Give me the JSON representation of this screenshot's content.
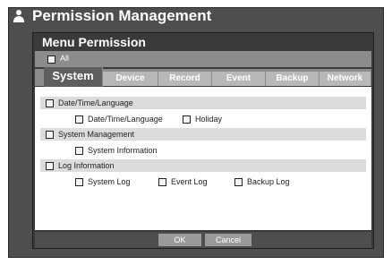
{
  "window": {
    "title": "Permission Management"
  },
  "dialog": {
    "title": "Menu Permission",
    "all_label": "All",
    "tabs": [
      {
        "label": "System"
      },
      {
        "label": "Device"
      },
      {
        "label": "Record"
      },
      {
        "label": "Event"
      },
      {
        "label": "Backup"
      },
      {
        "label": "Network"
      }
    ],
    "active_tab": "System",
    "groups": [
      {
        "label": "Date/Time/Language",
        "items": [
          {
            "label": "Date/Time/Language"
          },
          {
            "label": "Holiday"
          }
        ]
      },
      {
        "label": "System Management",
        "items": [
          {
            "label": "System Information"
          }
        ]
      },
      {
        "label": "Log Information",
        "items": [
          {
            "label": "System Log"
          },
          {
            "label": "Event Log"
          },
          {
            "label": "Backup Log"
          }
        ]
      }
    ],
    "buttons": {
      "ok": "OK",
      "cancel": "Cancel"
    }
  },
  "colors": {
    "panel": "#4e4e4e",
    "dialog": "#3a3a3a",
    "tab_inactive": "#b8b8b8",
    "tab_active": "#5e5e5e",
    "group_bar": "#dcdcdc"
  }
}
